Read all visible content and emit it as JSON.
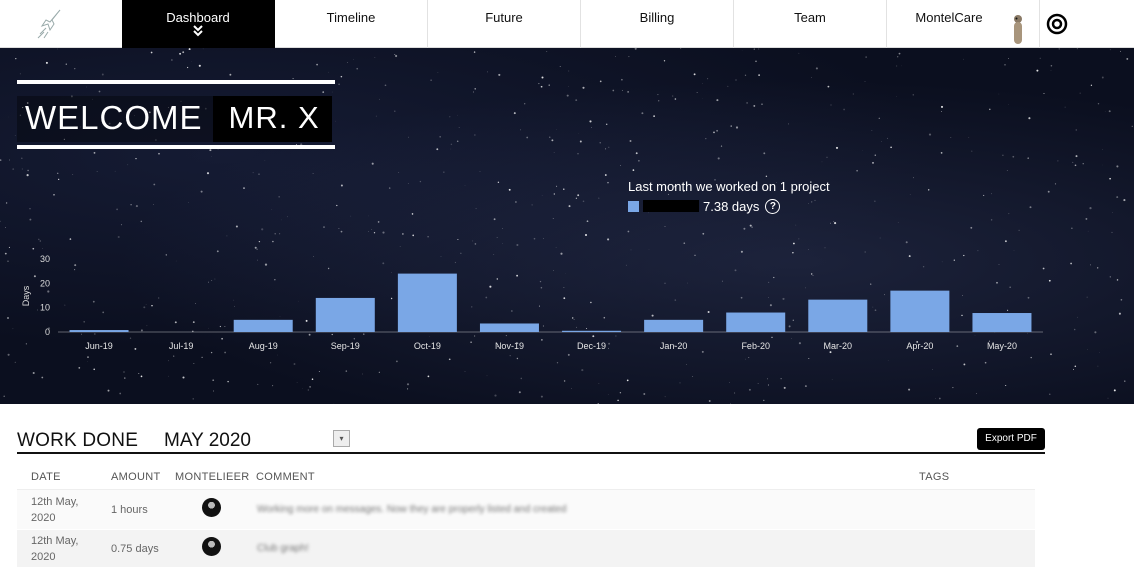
{
  "nav": {
    "items": [
      {
        "label": "Dashboard",
        "active": true
      },
      {
        "label": "Timeline"
      },
      {
        "label": "Future"
      },
      {
        "label": "Billing"
      },
      {
        "label": "Team"
      },
      {
        "label": "MontelCare"
      }
    ],
    "active_indicator": "chevron-double-down-icon"
  },
  "hero": {
    "welcome": "WELCOME",
    "name": "MR. X",
    "summary": "Last month we worked on 1 project",
    "days": "7.38 days",
    "help": "?"
  },
  "chart_data": {
    "type": "bar",
    "ylabel": "Days",
    "ylim": [
      0,
      30
    ],
    "yticks": [
      0,
      10,
      20,
      30
    ],
    "categories": [
      "Jun-19",
      "Jul-19",
      "Aug-19",
      "Sep-19",
      "Oct-19",
      "Nov-19",
      "Dec-19",
      "Jan-20",
      "Feb-20",
      "Mar-20",
      "Apr-20",
      "May-20"
    ],
    "values": [
      0.8,
      0,
      5,
      14,
      24,
      3.5,
      0.5,
      5,
      8,
      13.3,
      17,
      7.8
    ],
    "color": "#7aa7e6"
  },
  "work": {
    "title": "WORK DONE",
    "month": "MAY 2020",
    "select_icon": "▾",
    "export": "Export PDF",
    "columns": [
      "DATE",
      "AMOUNT",
      "MONTELIEER",
      "COMMENT",
      "TAGS"
    ],
    "rows": [
      {
        "date_line1": "12th May,",
        "date_line2": "2020",
        "amount": "1 hours",
        "comment": "Working more on messages. Now they are properly listed and created"
      },
      {
        "date_line1": "12th May,",
        "date_line2": "2020",
        "amount": "0.75 days",
        "comment": "Club graph!"
      }
    ]
  }
}
